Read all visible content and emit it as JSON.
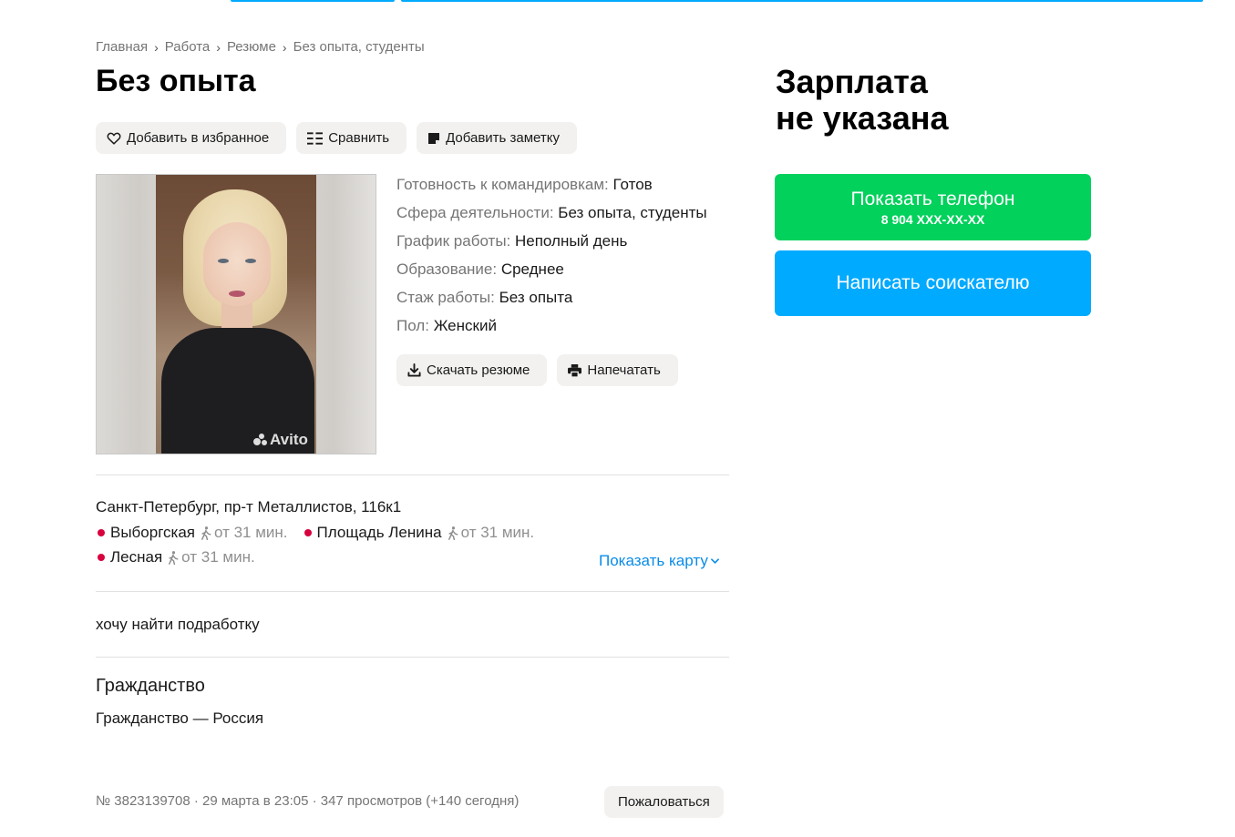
{
  "breadcrumbs": [
    "Главная",
    "Работа",
    "Резюме",
    "Без опыта, студенты"
  ],
  "title": "Без опыта",
  "actions": {
    "favorite": "Добавить в избранное",
    "compare": "Сравнить",
    "note": "Добавить заметку"
  },
  "photo": {
    "watermark": "Avito"
  },
  "params": [
    {
      "key": "Готовность к командировкам:",
      "value": "Готов"
    },
    {
      "key": "Сфера деятельности:",
      "value": "Без опыта, студенты"
    },
    {
      "key": "График работы:",
      "value": "Неполный день"
    },
    {
      "key": "Образование:",
      "value": "Среднее"
    },
    {
      "key": "Стаж работы:",
      "value": "Без опыта"
    },
    {
      "key": "Пол:",
      "value": "Женский"
    }
  ],
  "resume_actions": {
    "download": "Скачать резюме",
    "print": "Напечатать"
  },
  "location": {
    "address": "Санкт-Петербург, пр-т Металлистов, 116к1",
    "metro": [
      {
        "name": "Выборгская",
        "time": "от 31 мин.",
        "color": "#d8003d"
      },
      {
        "name": "Площадь Ленина",
        "time": "от 31 мин.",
        "color": "#d8003d"
      },
      {
        "name": "Лесная",
        "time": "от 31 мин.",
        "color": "#d8003d"
      }
    ],
    "show_map": "Показать карту"
  },
  "description": "хочу найти подработку",
  "citizenship": {
    "title": "Гражданство",
    "value": "Гражданство — Россия"
  },
  "footer": {
    "meta": "№ 3823139708 · 29 марта в 23:05 · 347 просмотров (+140 сегодня)",
    "complain": "Пожаловаться"
  },
  "sidebar": {
    "salary_line1": "Зарплата",
    "salary_line2": "не указана",
    "phone_button": "Показать телефон",
    "phone_number": "8 904 XXX-XX-XX",
    "write_button": "Написать соискателю"
  },
  "colors": {
    "accent_blue": "#00aaff",
    "accent_green": "#02d15c",
    "metro_red": "#d8003d",
    "link": "#0a8ce8"
  }
}
